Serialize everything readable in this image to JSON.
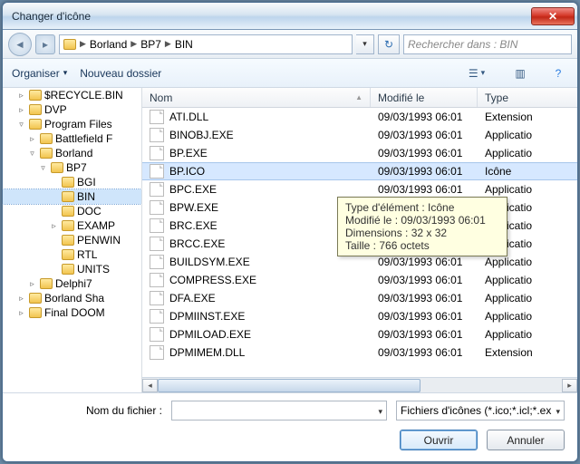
{
  "window": {
    "title": "Changer d'icône"
  },
  "breadcrumbs": [
    "Borland",
    "BP7",
    "BIN"
  ],
  "search": {
    "placeholder": "Rechercher dans : BIN"
  },
  "toolbar": {
    "organize": "Organiser",
    "new_folder": "Nouveau dossier"
  },
  "tree": [
    {
      "indent": 1,
      "tw": "▹",
      "label": "$RECYCLE.BIN",
      "sel": false
    },
    {
      "indent": 1,
      "tw": "▹",
      "label": "DVP",
      "sel": false
    },
    {
      "indent": 1,
      "tw": "▿",
      "label": "Program Files",
      "sel": false
    },
    {
      "indent": 2,
      "tw": "▹",
      "label": "Battlefield F",
      "sel": false
    },
    {
      "indent": 2,
      "tw": "▿",
      "label": "Borland",
      "sel": false
    },
    {
      "indent": 3,
      "tw": "▿",
      "label": "BP7",
      "sel": false
    },
    {
      "indent": 4,
      "tw": "",
      "label": "BGI",
      "sel": false
    },
    {
      "indent": 4,
      "tw": "",
      "label": "BIN",
      "sel": true
    },
    {
      "indent": 4,
      "tw": "",
      "label": "DOC",
      "sel": false
    },
    {
      "indent": 4,
      "tw": "▹",
      "label": "EXAMP",
      "sel": false
    },
    {
      "indent": 4,
      "tw": "",
      "label": "PENWIN",
      "sel": false
    },
    {
      "indent": 4,
      "tw": "",
      "label": "RTL",
      "sel": false
    },
    {
      "indent": 4,
      "tw": "",
      "label": "UNITS",
      "sel": false
    },
    {
      "indent": 2,
      "tw": "▹",
      "label": "Delphi7",
      "sel": false
    },
    {
      "indent": 1,
      "tw": "▹",
      "label": "Borland Sha",
      "sel": false
    },
    {
      "indent": 1,
      "tw": "▹",
      "label": "Final DOOM",
      "sel": false
    }
  ],
  "columns": {
    "name": "Nom",
    "modified": "Modifié le",
    "type": "Type"
  },
  "files": [
    {
      "name": "ATI.DLL",
      "modified": "09/03/1993 06:01",
      "type": "Extension",
      "sel": false
    },
    {
      "name": "BINOBJ.EXE",
      "modified": "09/03/1993 06:01",
      "type": "Applicatio",
      "sel": false
    },
    {
      "name": "BP.EXE",
      "modified": "09/03/1993 06:01",
      "type": "Applicatio",
      "sel": false
    },
    {
      "name": "BP.ICO",
      "modified": "09/03/1993 06:01",
      "type": "Icône",
      "sel": true
    },
    {
      "name": "BPC.EXE",
      "modified": "09/03/1993 06:01",
      "type": "Applicatio",
      "sel": false
    },
    {
      "name": "BPW.EXE",
      "modified": "09/03/1993 06:01",
      "type": "Applicatio",
      "sel": false
    },
    {
      "name": "BRC.EXE",
      "modified": "09/03/1993 06:01",
      "type": "Applicatio",
      "sel": false
    },
    {
      "name": "BRCC.EXE",
      "modified": "09/03/1993 06:01",
      "type": "Applicatio",
      "sel": false
    },
    {
      "name": "BUILDSYM.EXE",
      "modified": "09/03/1993 06:01",
      "type": "Applicatio",
      "sel": false
    },
    {
      "name": "COMPRESS.EXE",
      "modified": "09/03/1993 06:01",
      "type": "Applicatio",
      "sel": false
    },
    {
      "name": "DFA.EXE",
      "modified": "09/03/1993 06:01",
      "type": "Applicatio",
      "sel": false
    },
    {
      "name": "DPMIINST.EXE",
      "modified": "09/03/1993 06:01",
      "type": "Applicatio",
      "sel": false
    },
    {
      "name": "DPMILOAD.EXE",
      "modified": "09/03/1993 06:01",
      "type": "Applicatio",
      "sel": false
    },
    {
      "name": "DPMIMEM.DLL",
      "modified": "09/03/1993 06:01",
      "type": "Extension",
      "sel": false
    }
  ],
  "tooltip": {
    "line1": "Type d'élément : Icône",
    "line2": "Modifié le : 09/03/1993 06:01",
    "line3": "Dimensions : 32 x 32",
    "line4": "Taille : 766 octets"
  },
  "footer": {
    "filename_label": "Nom du fichier :",
    "filter": "Fichiers d'icônes (*.ico;*.icl;*.ex",
    "open": "Ouvrir",
    "cancel": "Annuler"
  }
}
